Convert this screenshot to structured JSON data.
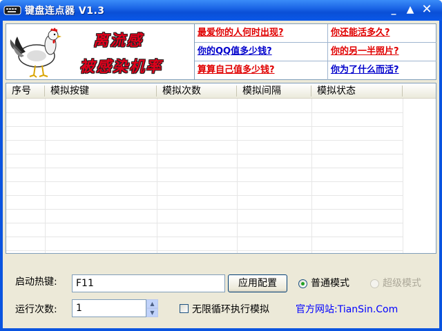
{
  "window": {
    "title": "键盘连点器 V1.3",
    "icon": "keyboard-icon",
    "controls": {
      "minimize": "_",
      "maximize": "▲",
      "close": "✕"
    }
  },
  "banner": {
    "ad_line1": "离流感",
    "ad_line2": "被感染机率",
    "links": [
      {
        "text": "最爱你的人何时出现?",
        "color": "#e00000"
      },
      {
        "text": "你还能活多久?",
        "color": "#e00000"
      },
      {
        "text": "你的QQ值多少钱?",
        "color": "#0000cc"
      },
      {
        "text": "你的另一半照片?",
        "color": "#e00000"
      },
      {
        "text": "算算自己值多少钱?",
        "color": "#e00000"
      },
      {
        "text": "你为了什么而活?",
        "color": "#0000cc"
      }
    ]
  },
  "table": {
    "columns": [
      "序号",
      "模拟按键",
      "模拟次数",
      "模拟间隔",
      "模拟状态"
    ],
    "rows": []
  },
  "controls": {
    "hotkey_label": "启动热键:",
    "hotkey_value": "F11",
    "apply_button": "应用配置",
    "mode_normal": "普通模式",
    "mode_super": "超级模式",
    "selected_mode": "普通模式",
    "run_count_label": "运行次数:",
    "run_count_value": "1",
    "infinite_loop_label": "无限循环执行模拟",
    "infinite_loop_checked": false,
    "website": "官方网站:TianSin.Com"
  }
}
